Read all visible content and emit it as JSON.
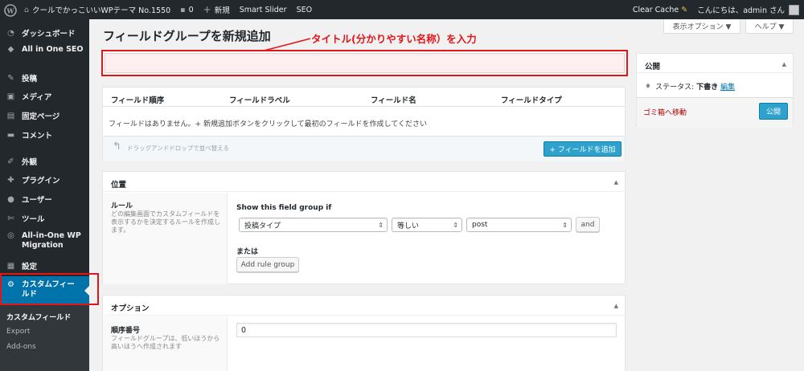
{
  "admin_bar": {
    "site_name": "クールでかっこいいWPテーマ No.1550",
    "comments_count": "0",
    "new_label": "新規",
    "smart_slider": "Smart Slider",
    "seo": "SEO",
    "clear_cache": "Clear Cache",
    "greeting": "こんにちは、admin さん"
  },
  "sidebar": {
    "items": [
      {
        "label": "ダッシュボード",
        "icon": "dashboard-icon"
      },
      {
        "label": "All in One SEO",
        "icon": "aioseo-shield-icon"
      },
      {
        "label": "投稿",
        "icon": "pin-icon"
      },
      {
        "label": "メディア",
        "icon": "media-icon"
      },
      {
        "label": "固定ページ",
        "icon": "page-icon"
      },
      {
        "label": "コメント",
        "icon": "comment-icon"
      },
      {
        "label": "外観",
        "icon": "brush-icon"
      },
      {
        "label": "プラグイン",
        "icon": "plugin-icon"
      },
      {
        "label": "ユーザー",
        "icon": "user-icon"
      },
      {
        "label": "ツール",
        "icon": "wrench-icon"
      },
      {
        "label": "All-in-One WP Migration",
        "icon": "migration-icon"
      },
      {
        "label": "設定",
        "icon": "settings-icon"
      },
      {
        "label": "カスタムフィールド",
        "icon": "gear-icon"
      }
    ],
    "submenu": [
      "カスタムフィールド",
      "Export",
      "Add-ons"
    ]
  },
  "header": {
    "title": "フィールドグループを新規追加",
    "screen_options": "表示オプション ▼",
    "help": "ヘルプ ▼"
  },
  "annotation": "タイトル(分かりやすい名称）を入力",
  "title_input": {
    "value": ""
  },
  "fields": {
    "columns": [
      "フィールド順序",
      "フィールドラベル",
      "フィールド名",
      "フィールドタイプ"
    ],
    "empty_message": "フィールドはありません。+ 新規追加ボタンをクリックして最初のフィールドを作成してください",
    "drag_hint": "ドラッグアンドドロップで並べ替える",
    "add_button": "+ フィールドを追加"
  },
  "location": {
    "title": "位置",
    "rules_label": "ルール",
    "rules_desc": "どの編集画面でカスタムフィールドを表示するかを決定するルールを作成します。",
    "show_if": "Show this field group if",
    "param": "投稿タイプ",
    "operator": "等しい",
    "value": "post",
    "and_button": "and",
    "or_label": "または",
    "add_rule_group": "Add rule group"
  },
  "options": {
    "title": "オプション",
    "order_label": "順序番号",
    "order_desc": "フィールドグループは、低いほうから高いほうへ作成されます",
    "order_value": "0"
  },
  "publish": {
    "title": "公開",
    "status_label": "ステータス:",
    "status_value": "下書き",
    "edit_link": "編集",
    "trash_link": "ゴミ箱へ移動",
    "publish_button": "公開"
  },
  "colors": {
    "admin_dark": "#23282d",
    "accent_blue": "#0073aa",
    "button_blue": "#2ea2cc",
    "annotation_red": "#e0161b"
  }
}
